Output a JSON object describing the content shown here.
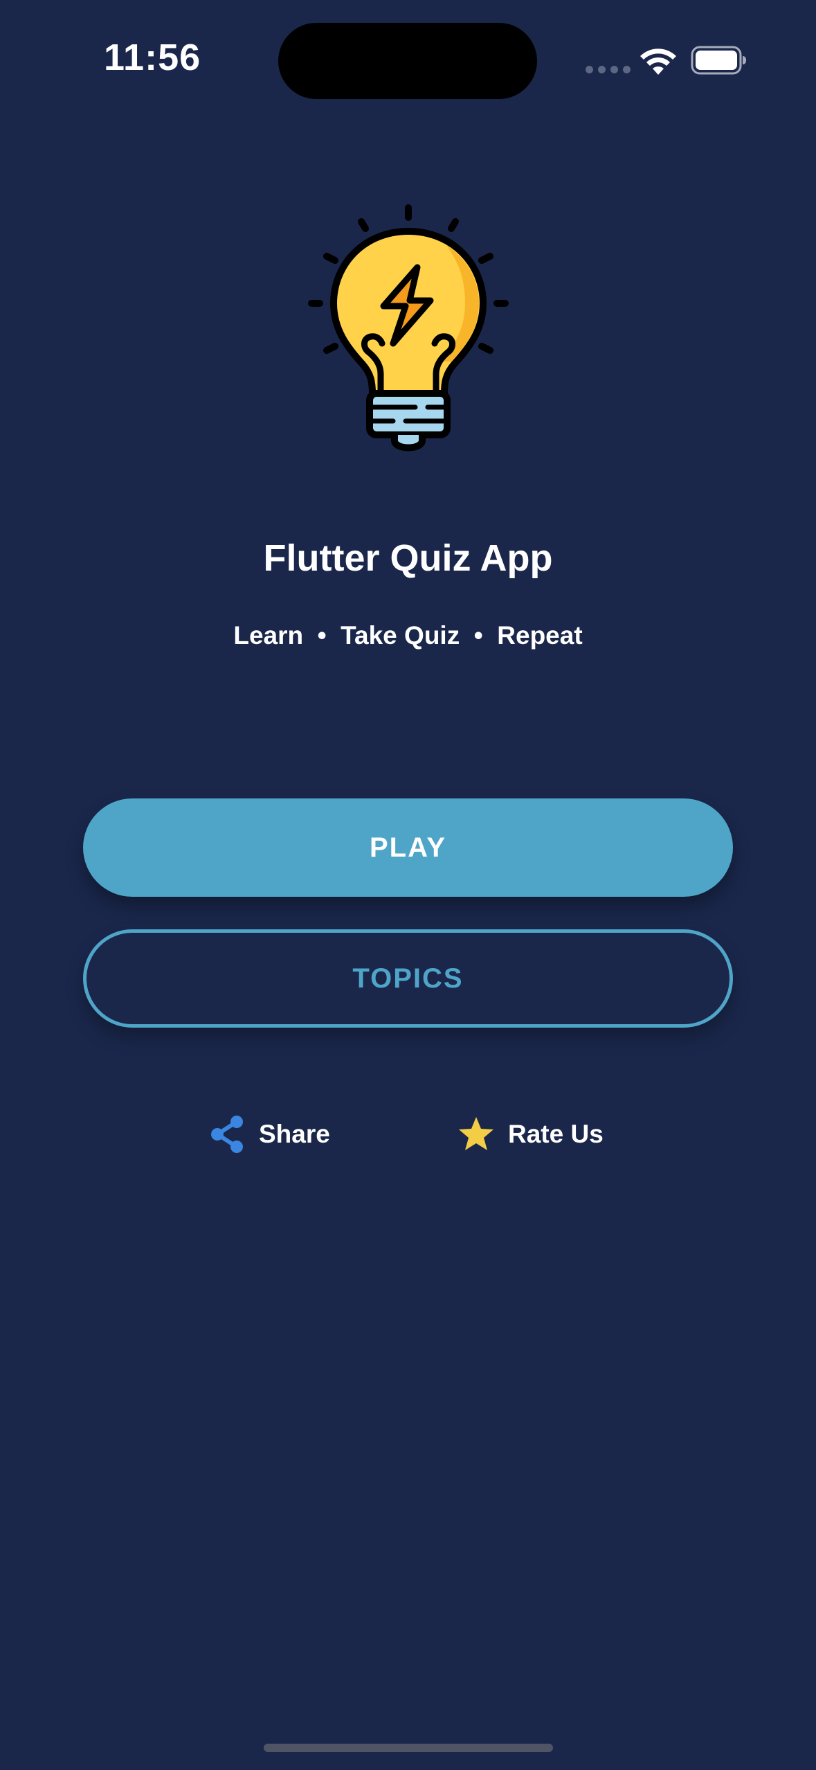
{
  "status_bar": {
    "time": "11:56",
    "icons": [
      "signal-icon",
      "wifi-icon",
      "battery-icon"
    ]
  },
  "hero": {
    "icon": "lightbulb-lightning-icon",
    "title": "Flutter Quiz App",
    "tagline": "Learn  •  Take Quiz  •  Repeat"
  },
  "buttons": {
    "play_label": "PLAY",
    "topics_label": "TOPICS"
  },
  "actions": {
    "share_label": "Share",
    "share_icon": "share-icon",
    "rate_label": "Rate Us",
    "rate_icon": "star-icon"
  },
  "colors": {
    "background": "#1a274b",
    "accent": "#4fa5c8",
    "share_icon": "#3b86e0",
    "star": "#f3cd46",
    "bulb": "#ffd24a"
  }
}
